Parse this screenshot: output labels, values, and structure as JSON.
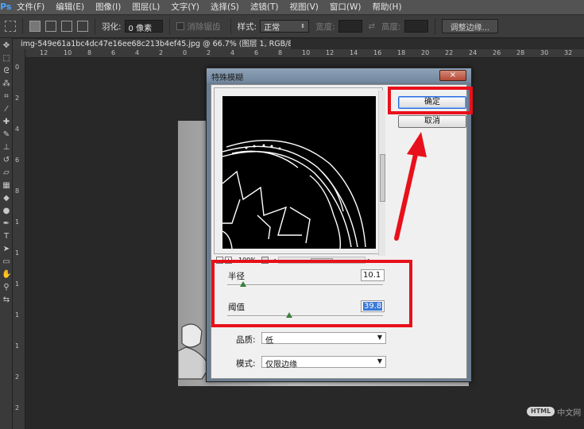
{
  "app": {
    "logo": "Ps"
  },
  "menu": [
    "文件(F)",
    "编辑(E)",
    "图像(I)",
    "图层(L)",
    "文字(Y)",
    "选择(S)",
    "滤镜(T)",
    "视图(V)",
    "窗口(W)",
    "帮助(H)"
  ],
  "options": {
    "feather_label": "羽化:",
    "feather_value": "0 像素",
    "antialias_label": "消除锯齿",
    "style_label": "样式:",
    "style_value": "正常",
    "width_label": "宽度:",
    "height_label": "高度:",
    "refine_edge": "调整边缘..."
  },
  "tab": {
    "label": "img-549e61a1bc4dc47e16ee68c213b4ef45.jpg @ 66.7% (图层 1, RGB/8#) *",
    "close": "×"
  },
  "ruler": {
    "h": [
      "12",
      "10",
      "8",
      "6",
      "4",
      "2",
      "0",
      "2",
      "4",
      "6",
      "8",
      "10",
      "12",
      "14",
      "16",
      "18",
      "20",
      "22",
      "24",
      "26",
      "28",
      "30",
      "32"
    ],
    "v": [
      "0",
      "2",
      "4",
      "6",
      "8",
      "1",
      "1",
      "1",
      "1",
      "1",
      "2",
      "2"
    ]
  },
  "dialog": {
    "title": "特殊模糊",
    "close": "×",
    "ok": "确定",
    "cancel": "取消",
    "zoom": "100%",
    "zoom_minus": "−",
    "zoom_plus": "+",
    "radius_label": "半径",
    "radius_value": "10.1",
    "radius_level": 0.1,
    "threshold_label": "阈值",
    "threshold_value": "39.8",
    "threshold_level": 0.4,
    "quality_label": "品质:",
    "quality_value": "低",
    "mode_label": "模式:",
    "mode_value": "仅限边缘"
  },
  "watermark": {
    "badge": "HTML",
    "text": "中文网"
  },
  "colors": {
    "highlight": "#e8101a",
    "foreground": "#ffffff",
    "background": "#0b0b60"
  }
}
